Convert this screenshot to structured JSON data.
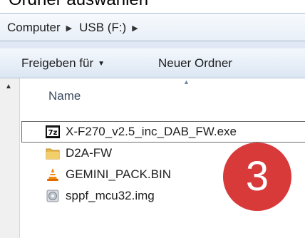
{
  "top_caption": "Ordner auswählen",
  "breadcrumb": {
    "items": [
      {
        "label": "Computer"
      },
      {
        "label": "USB (F:)"
      }
    ],
    "separator": "▶"
  },
  "toolbar": {
    "share_label": "Freigeben für",
    "share_arrow": "▼",
    "new_folder_label": "Neuer Ordner"
  },
  "columns": {
    "name_label": "Name",
    "sort_indicator": "▲"
  },
  "files": [
    {
      "name": "X-F270_v2.5_inc_DAB_FW.exe",
      "icon": "7zip-archive-icon"
    },
    {
      "name": "D2A-FW",
      "icon": "folder-icon"
    },
    {
      "name": "GEMINI_PACK.BIN",
      "icon": "vlc-cone-icon"
    },
    {
      "name": "sppf_mcu32.img",
      "icon": "disc-image-icon"
    }
  ],
  "scroll": {
    "up_arrow": "▲"
  },
  "step_badge": {
    "number": "3",
    "color": "#d83a3a"
  }
}
